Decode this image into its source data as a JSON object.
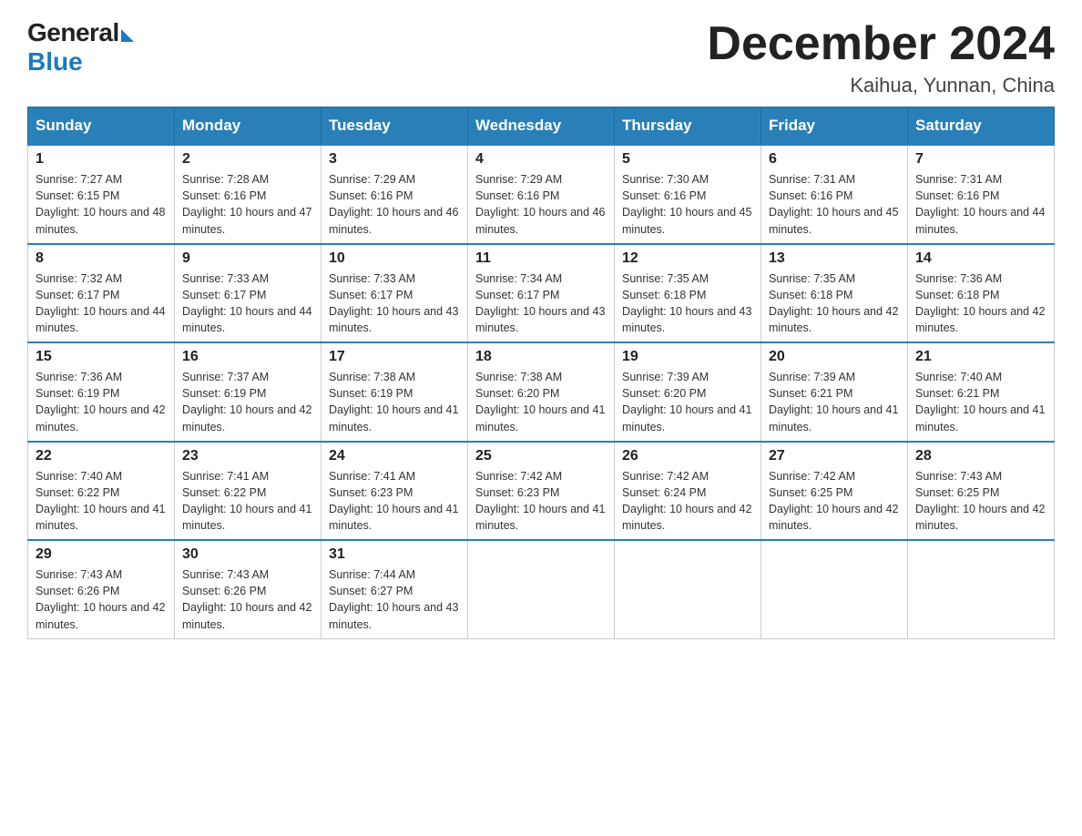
{
  "logo": {
    "general": "General",
    "blue": "Blue"
  },
  "title": "December 2024",
  "subtitle": "Kaihua, Yunnan, China",
  "headers": [
    "Sunday",
    "Monday",
    "Tuesday",
    "Wednesday",
    "Thursday",
    "Friday",
    "Saturday"
  ],
  "weeks": [
    [
      {
        "num": "1",
        "sunrise": "7:27 AM",
        "sunset": "6:15 PM",
        "daylight": "10 hours and 48 minutes."
      },
      {
        "num": "2",
        "sunrise": "7:28 AM",
        "sunset": "6:16 PM",
        "daylight": "10 hours and 47 minutes."
      },
      {
        "num": "3",
        "sunrise": "7:29 AM",
        "sunset": "6:16 PM",
        "daylight": "10 hours and 46 minutes."
      },
      {
        "num": "4",
        "sunrise": "7:29 AM",
        "sunset": "6:16 PM",
        "daylight": "10 hours and 46 minutes."
      },
      {
        "num": "5",
        "sunrise": "7:30 AM",
        "sunset": "6:16 PM",
        "daylight": "10 hours and 45 minutes."
      },
      {
        "num": "6",
        "sunrise": "7:31 AM",
        "sunset": "6:16 PM",
        "daylight": "10 hours and 45 minutes."
      },
      {
        "num": "7",
        "sunrise": "7:31 AM",
        "sunset": "6:16 PM",
        "daylight": "10 hours and 44 minutes."
      }
    ],
    [
      {
        "num": "8",
        "sunrise": "7:32 AM",
        "sunset": "6:17 PM",
        "daylight": "10 hours and 44 minutes."
      },
      {
        "num": "9",
        "sunrise": "7:33 AM",
        "sunset": "6:17 PM",
        "daylight": "10 hours and 44 minutes."
      },
      {
        "num": "10",
        "sunrise": "7:33 AM",
        "sunset": "6:17 PM",
        "daylight": "10 hours and 43 minutes."
      },
      {
        "num": "11",
        "sunrise": "7:34 AM",
        "sunset": "6:17 PM",
        "daylight": "10 hours and 43 minutes."
      },
      {
        "num": "12",
        "sunrise": "7:35 AM",
        "sunset": "6:18 PM",
        "daylight": "10 hours and 43 minutes."
      },
      {
        "num": "13",
        "sunrise": "7:35 AM",
        "sunset": "6:18 PM",
        "daylight": "10 hours and 42 minutes."
      },
      {
        "num": "14",
        "sunrise": "7:36 AM",
        "sunset": "6:18 PM",
        "daylight": "10 hours and 42 minutes."
      }
    ],
    [
      {
        "num": "15",
        "sunrise": "7:36 AM",
        "sunset": "6:19 PM",
        "daylight": "10 hours and 42 minutes."
      },
      {
        "num": "16",
        "sunrise": "7:37 AM",
        "sunset": "6:19 PM",
        "daylight": "10 hours and 42 minutes."
      },
      {
        "num": "17",
        "sunrise": "7:38 AM",
        "sunset": "6:19 PM",
        "daylight": "10 hours and 41 minutes."
      },
      {
        "num": "18",
        "sunrise": "7:38 AM",
        "sunset": "6:20 PM",
        "daylight": "10 hours and 41 minutes."
      },
      {
        "num": "19",
        "sunrise": "7:39 AM",
        "sunset": "6:20 PM",
        "daylight": "10 hours and 41 minutes."
      },
      {
        "num": "20",
        "sunrise": "7:39 AM",
        "sunset": "6:21 PM",
        "daylight": "10 hours and 41 minutes."
      },
      {
        "num": "21",
        "sunrise": "7:40 AM",
        "sunset": "6:21 PM",
        "daylight": "10 hours and 41 minutes."
      }
    ],
    [
      {
        "num": "22",
        "sunrise": "7:40 AM",
        "sunset": "6:22 PM",
        "daylight": "10 hours and 41 minutes."
      },
      {
        "num": "23",
        "sunrise": "7:41 AM",
        "sunset": "6:22 PM",
        "daylight": "10 hours and 41 minutes."
      },
      {
        "num": "24",
        "sunrise": "7:41 AM",
        "sunset": "6:23 PM",
        "daylight": "10 hours and 41 minutes."
      },
      {
        "num": "25",
        "sunrise": "7:42 AM",
        "sunset": "6:23 PM",
        "daylight": "10 hours and 41 minutes."
      },
      {
        "num": "26",
        "sunrise": "7:42 AM",
        "sunset": "6:24 PM",
        "daylight": "10 hours and 42 minutes."
      },
      {
        "num": "27",
        "sunrise": "7:42 AM",
        "sunset": "6:25 PM",
        "daylight": "10 hours and 42 minutes."
      },
      {
        "num": "28",
        "sunrise": "7:43 AM",
        "sunset": "6:25 PM",
        "daylight": "10 hours and 42 minutes."
      }
    ],
    [
      {
        "num": "29",
        "sunrise": "7:43 AM",
        "sunset": "6:26 PM",
        "daylight": "10 hours and 42 minutes."
      },
      {
        "num": "30",
        "sunrise": "7:43 AM",
        "sunset": "6:26 PM",
        "daylight": "10 hours and 42 minutes."
      },
      {
        "num": "31",
        "sunrise": "7:44 AM",
        "sunset": "6:27 PM",
        "daylight": "10 hours and 43 minutes."
      },
      null,
      null,
      null,
      null
    ]
  ]
}
